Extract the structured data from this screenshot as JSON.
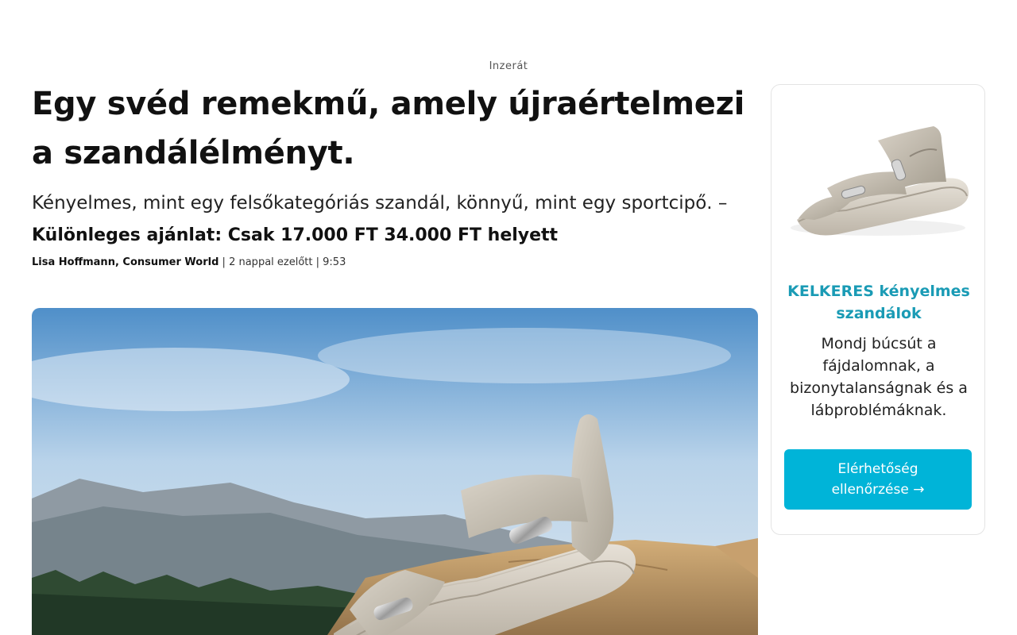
{
  "ad_label": "Inzerát",
  "article": {
    "headline": "Egy svéd remekmű, amely újraértelmezi a szandálélményt.",
    "subhead": "Kényelmes, mint egy felsőkategóriás szandál, könnyű, mint egy sportcipő. –",
    "offer": "Különleges ajánlat: Csak 17.000 FT 34.000 FT helyett",
    "byline": {
      "author": "Lisa Hoffmann, Consumer World",
      "separator": " | ",
      "time_ago": "2 nappal ezelőtt",
      "time": "9:53"
    }
  },
  "sidebar": {
    "title": "KELKERES kényelmes szandálok",
    "text": "Mondj búcsút a fájdalomnak, a bizonytalanságnak és a lábproblémáknak.",
    "cta_label": "Elérhetőség ellenőrzése →",
    "accent_color": "#1a9bb5",
    "button_color": "#00b4d8"
  }
}
